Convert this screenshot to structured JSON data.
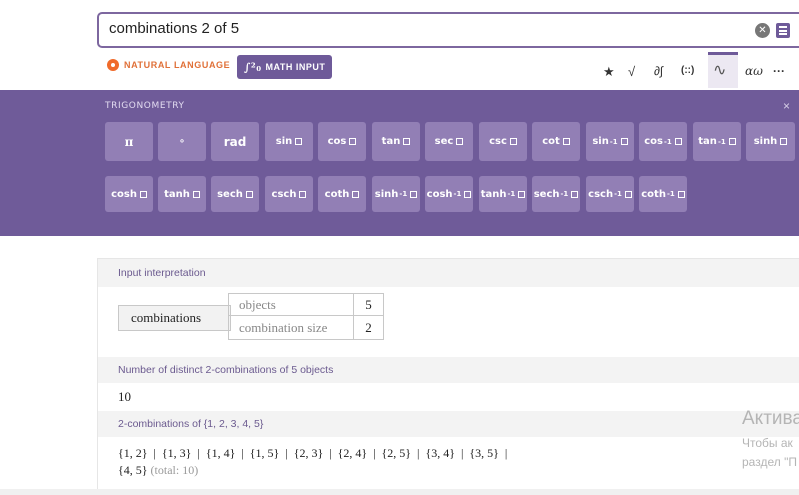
{
  "search": {
    "value": "combinations 2 of 5"
  },
  "modes": {
    "natural_language": "NATURAL LANGUAGE",
    "math_input": "MATH INPUT"
  },
  "toolbar": {
    "star": "★",
    "sqrt": "√",
    "derivative": "∂∫",
    "matrix": "(::)",
    "trig": "∿",
    "greek": "αω",
    "more": "···"
  },
  "palette": {
    "title": "TRIGONOMETRY",
    "close": "×",
    "row1": [
      "π",
      "∘",
      "rad",
      "sin",
      "cos",
      "tan",
      "sec",
      "csc",
      "cot",
      "sin",
      "cos",
      "tan",
      "sinh"
    ],
    "row2": [
      "cosh",
      "tanh",
      "sech",
      "csch",
      "coth",
      "sinh",
      "cosh",
      "tanh",
      "sech",
      "csch",
      "coth"
    ]
  },
  "pods": {
    "interp": {
      "header": "Input interpretation",
      "name": "combinations",
      "objects_label": "objects",
      "objects_value": "5",
      "size_label": "combination size",
      "size_value": "2"
    },
    "count": {
      "header": "Number of distinct 2-combinations of 5 objects",
      "value": "10"
    },
    "list": {
      "header": "2-combinations of {1, 2, 3, 4, 5}",
      "line1": "{1, 2}  |  {1, 3}  |  {1, 4}  |  {1, 5}  |  {2, 3}  |  {2, 4}  |  {2, 5}  |  {3, 4}  |  {3, 5}  |",
      "line2": "{4, 5}",
      "total": "(total: 10)"
    }
  },
  "watermark": {
    "title": "Актива",
    "line1": "Чтобы ак",
    "line2": "раздел \"П"
  }
}
